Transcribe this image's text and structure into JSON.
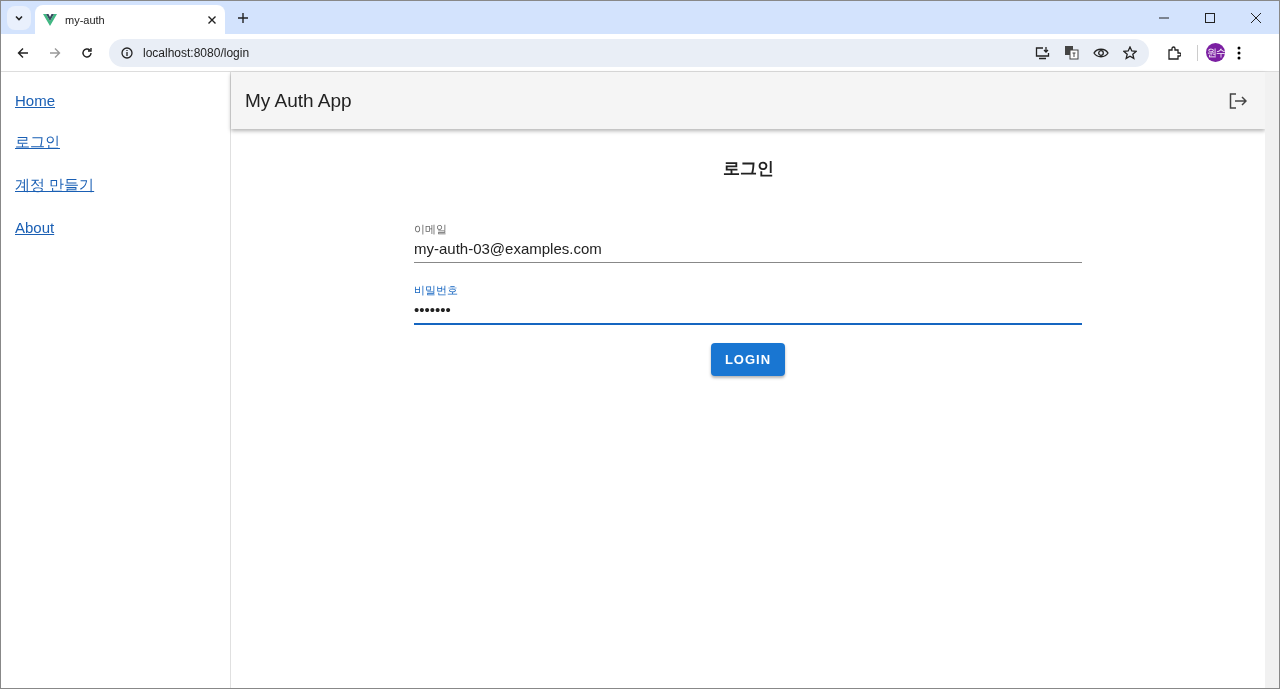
{
  "browser": {
    "tab": {
      "title": "my-auth"
    },
    "url": "localhost:8080/login",
    "profile": "원수"
  },
  "sidebar": {
    "items": [
      {
        "label": "Home"
      },
      {
        "label": "로그인"
      },
      {
        "label": "계정 만들기"
      },
      {
        "label": "About"
      }
    ]
  },
  "app_bar": {
    "title": "My Auth App"
  },
  "form": {
    "title": "로그인",
    "fields": [
      {
        "label": "이메일",
        "value": "my-auth-03@examples.com",
        "focused": false
      },
      {
        "label": "비밀번호",
        "value": "•••••••",
        "focused": true
      }
    ],
    "button": "LOGIN"
  }
}
